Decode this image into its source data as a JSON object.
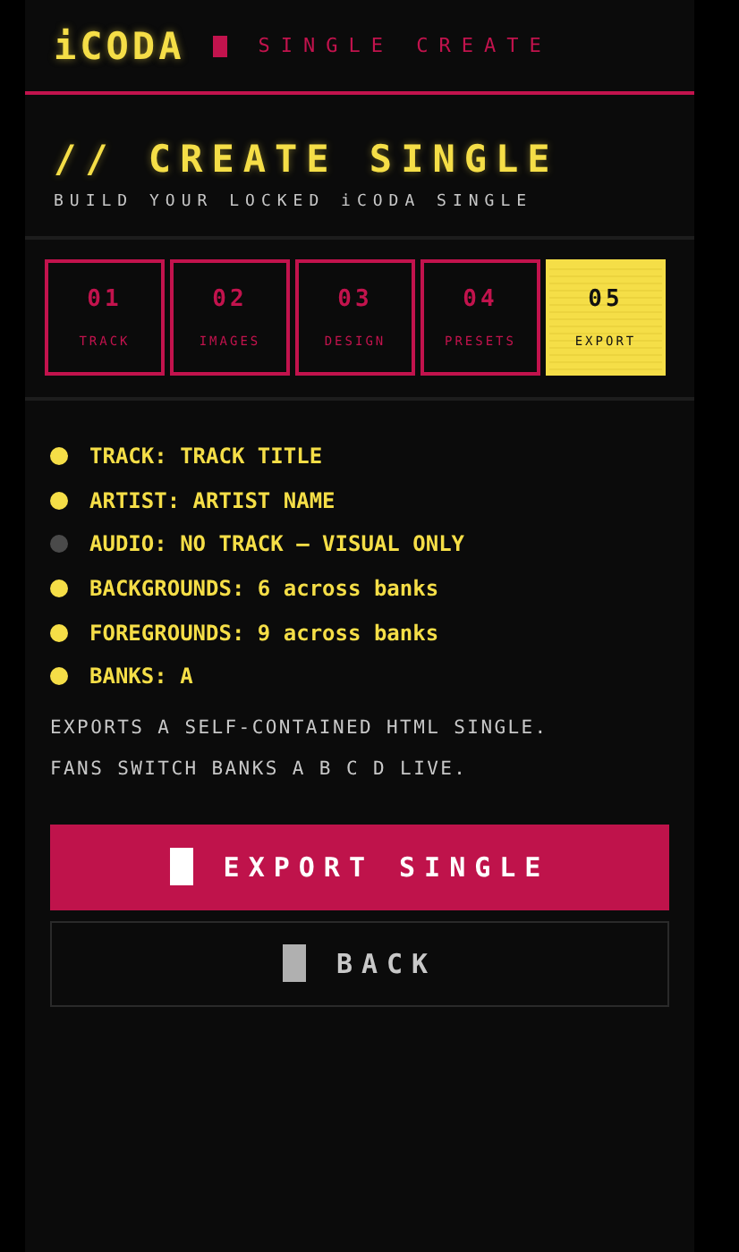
{
  "header": {
    "logo": "iCODA",
    "subtitle": "SINGLE CREATE"
  },
  "page": {
    "title": "// CREATE SINGLE",
    "subtitle": "BUILD YOUR LOCKED iCODA SINGLE"
  },
  "steps": [
    {
      "number": "01",
      "label": "TRACK",
      "selected": false
    },
    {
      "number": "02",
      "label": "IMAGES",
      "selected": false
    },
    {
      "number": "03",
      "label": "DESIGN",
      "selected": false
    },
    {
      "number": "04",
      "label": "PRESETS",
      "selected": false
    },
    {
      "number": "05",
      "label": "EXPORT",
      "selected": true
    }
  ],
  "summary": [
    {
      "text": "TRACK: TRACK TITLE",
      "on": true
    },
    {
      "text": "ARTIST: ARTIST NAME",
      "on": true
    },
    {
      "text": "AUDIO: NO TRACK — VISUAL ONLY",
      "on": false
    },
    {
      "text": "BACKGROUNDS: 6 across banks",
      "on": true
    },
    {
      "text": "FOREGROUNDS: 9 across banks",
      "on": true
    },
    {
      "text": "BANKS: A",
      "on": true
    }
  ],
  "notes": [
    "EXPORTS A SELF-CONTAINED HTML SINGLE.",
    "FANS SWITCH BANKS A B C D LIVE."
  ],
  "buttons": [
    {
      "label": "EXPORT SINGLE",
      "kind": "primary"
    },
    {
      "label": "BACK",
      "kind": "secondary"
    }
  ]
}
